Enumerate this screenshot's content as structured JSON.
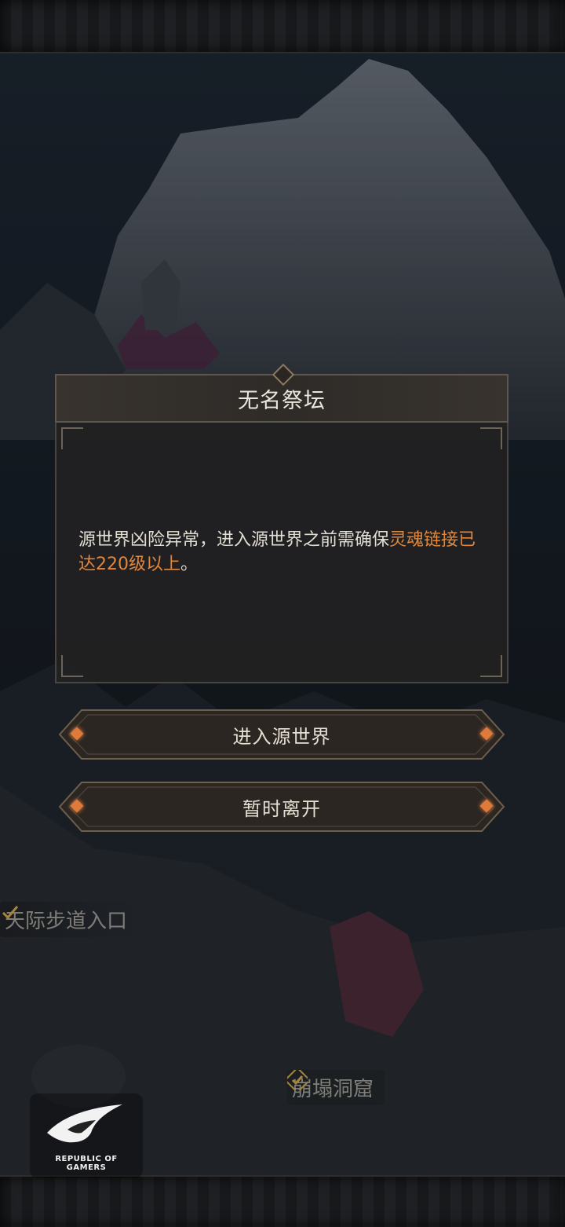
{
  "dialog": {
    "title": "无名祭坛",
    "message_plain": "源世界凶险异常，进入源世界之前需确保",
    "message_highlight": "灵魂链接已达220级以上",
    "message_end": "。"
  },
  "buttons": {
    "enter_label": "进入源世界",
    "leave_label": "暂时离开"
  },
  "map_labels": {
    "skyway_entrance": "天际步道入口",
    "collapsed_cave": "崩塌洞窟"
  },
  "overlay_logo": {
    "line1": "REPUBLIC OF",
    "line2": "GAMERS"
  },
  "colors": {
    "accent_orange": "#e0873e",
    "panel_bg": "#212122",
    "title_bar": "#38332e"
  },
  "icons": [
    "check-icon",
    "map-marker-icon",
    "rog-logo-icon"
  ]
}
